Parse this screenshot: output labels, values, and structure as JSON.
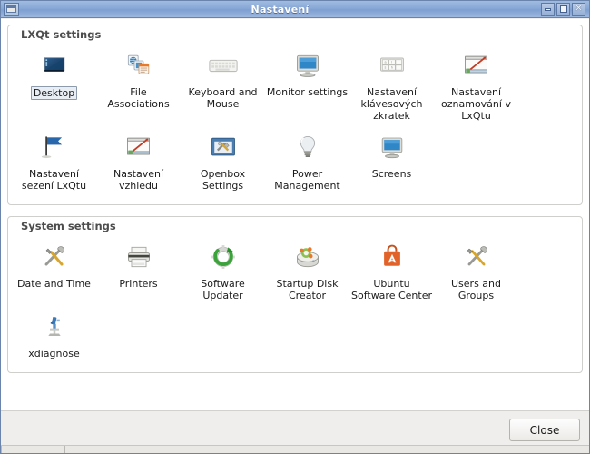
{
  "window": {
    "title": "Nastavení",
    "menu_icon": "window-menu-icon",
    "controls": [
      {
        "name": "minimize-button",
        "glyph": "minimize-icon"
      },
      {
        "name": "maximize-button",
        "glyph": "maximize-icon"
      },
      {
        "name": "close-button",
        "glyph": "close-icon"
      }
    ]
  },
  "groups": [
    {
      "title": "LXQt settings",
      "items": [
        {
          "label": "Desktop",
          "icon": "desktop-wallpaper-icon",
          "selected": true
        },
        {
          "label": "File Associations",
          "icon": "file-associations-icon",
          "selected": false
        },
        {
          "label": "Keyboard and Mouse",
          "icon": "keyboard-icon",
          "selected": false
        },
        {
          "label": "Monitor settings",
          "icon": "monitor-icon",
          "selected": false
        },
        {
          "label": "Nastavení klávesových zkratek",
          "icon": "keyboard-shortcuts-icon",
          "selected": false
        },
        {
          "label": "Nastavení oznamování v LxQtu",
          "icon": "notifications-window-icon",
          "selected": false
        },
        {
          "label": "Nastavení sezení LxQtu",
          "icon": "blue-flag-icon",
          "selected": false
        },
        {
          "label": "Nastavení vzhledu",
          "icon": "appearance-window-icon",
          "selected": false
        },
        {
          "label": "Openbox Settings",
          "icon": "openbox-tools-icon",
          "selected": false
        },
        {
          "label": "Power Management",
          "icon": "lightbulb-icon",
          "selected": false
        },
        {
          "label": "Screens",
          "icon": "screens-monitor-icon",
          "selected": false
        }
      ]
    },
    {
      "title": "System settings",
      "items": [
        {
          "label": "Date and Time",
          "icon": "screwdriver-wrench-icon",
          "selected": false
        },
        {
          "label": "Printers",
          "icon": "printer-icon",
          "selected": false
        },
        {
          "label": "Software Updater",
          "icon": "software-updater-icon",
          "selected": false
        },
        {
          "label": "Startup Disk Creator",
          "icon": "startup-disk-icon",
          "selected": false
        },
        {
          "label": "Ubuntu Software Center",
          "icon": "ubuntu-software-center-icon",
          "selected": false
        },
        {
          "label": "Users and Groups",
          "icon": "users-groups-icon",
          "selected": false
        },
        {
          "label": "xdiagnose",
          "icon": "microscope-icon",
          "selected": false
        }
      ]
    }
  ],
  "footer": {
    "close_label": "Close"
  },
  "colors": {
    "titlebar_start": "#9fbbe0",
    "titlebar_end": "#7e9fd0",
    "window_border": "#6b84ab",
    "panel_bg": "#ffffff",
    "footer_bg": "#efeeec",
    "group_border": "#cfcfcc",
    "selection_bg": "#e9eef5",
    "selection_border": "#8c9aab",
    "text": "#1b1b1b",
    "group_title_text": "#4d4d4d"
  }
}
